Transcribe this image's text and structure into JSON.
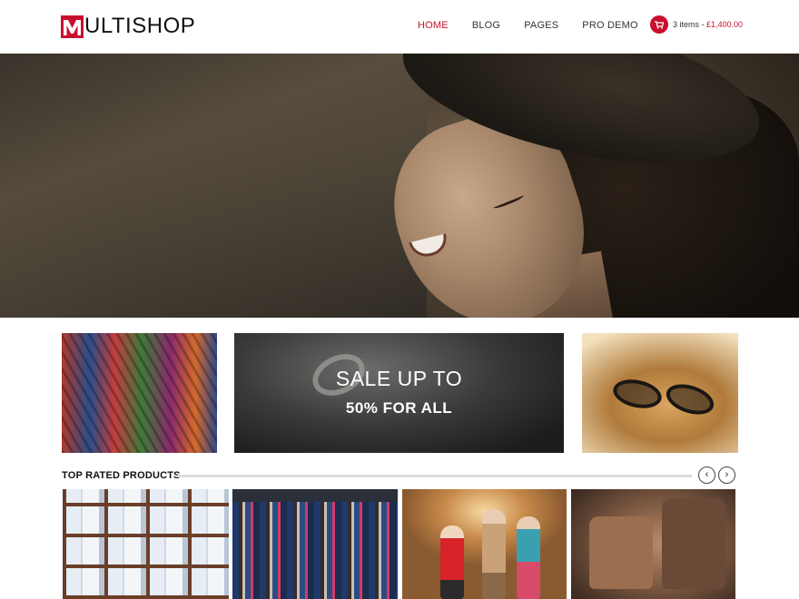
{
  "header": {
    "logo_letter": "M",
    "logo_text": "ULTISHOP",
    "nav": [
      {
        "label": "HOME",
        "active": true
      },
      {
        "label": "BLOG",
        "active": false
      },
      {
        "label": "PAGES",
        "active": false
      },
      {
        "label": "PRO DEMO",
        "active": false
      }
    ],
    "cart": {
      "items": "3 items",
      "separator": " - ",
      "total": "£1,400.00",
      "icon": "cart-icon"
    }
  },
  "promo": {
    "sale_line1": "SALE UP TO",
    "sale_line2": "50% FOR ALL"
  },
  "products_section": {
    "title": "TOP RATED PRODUCTS",
    "prev_icon": "chevron-left-icon",
    "next_icon": "chevron-right-icon",
    "prev_glyph": "‹",
    "next_glyph": "›"
  },
  "colors": {
    "accent": "#c8102e",
    "text": "#222222",
    "divider": "#dcdcdc"
  }
}
